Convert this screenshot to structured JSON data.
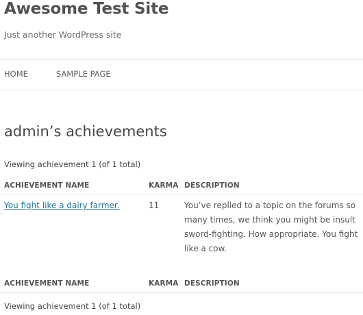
{
  "site": {
    "title": "Awesome Test Site",
    "description": "Just another WordPress site"
  },
  "nav": {
    "items": [
      {
        "label": "HOME"
      },
      {
        "label": "SAMPLE PAGE"
      }
    ]
  },
  "page": {
    "title": "admin’s achievements",
    "pagination_top": "Viewing achievement 1 (of 1 total)",
    "pagination_bottom": "Viewing achievement 1 (of 1 total)"
  },
  "table": {
    "columns": [
      "ACHIEVEMENT NAME",
      "KARMA",
      "DESCRIPTION"
    ],
    "rows": [
      {
        "name": "You fight like a dairy farmer.",
        "karma": "11",
        "description": "You’ve replied to a topic on the forums so many times, we think you might be insult sword-fighting. How appropriate. You fight like a cow."
      }
    ],
    "footer_columns": [
      "ACHIEVEMENT NAME",
      "KARMA",
      "DESCRIPTION"
    ]
  },
  "colors": {
    "link": "#21759b",
    "text": "#444444",
    "rule": "#e6e6e6"
  }
}
